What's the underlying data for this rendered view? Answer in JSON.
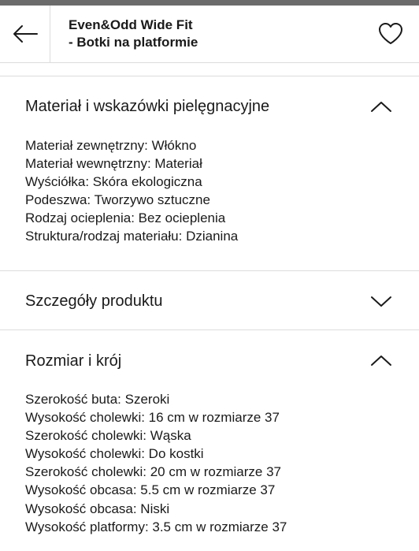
{
  "header": {
    "title_line1": "Even&Odd Wide Fit",
    "title_line2": "- Botki na platformie"
  },
  "sections": [
    {
      "title": "Materiał i wskazówki pielęgnacyjne",
      "expanded": true,
      "items": [
        "Materiał zewnętrzny: Włókno",
        "Materiał wewnętrzny: Materiał",
        "Wyściółka: Skóra ekologiczna",
        "Podeszwa: Tworzywo sztuczne",
        "Rodzaj ocieplenia: Bez ocieplenia",
        "Struktura/rodzaj materiału: Dzianina"
      ]
    },
    {
      "title": "Szczegóły produktu",
      "expanded": false,
      "items": []
    },
    {
      "title": "Rozmiar i krój",
      "expanded": true,
      "items": [
        "Szerokość buta: Szeroki",
        "Wysokość cholewki: 16 cm w rozmiarze 37",
        "Szerokość cholewki: Wąska",
        "Wysokość cholewki: Do kostki",
        "Szerokość cholewki: 20 cm w rozmiarze 37",
        "Wysokość obcasa: 5.5 cm w rozmiarze 37",
        "Wysokość obcasa: Niski",
        "Wysokość platformy: 3.5 cm w rozmiarze 37"
      ]
    }
  ],
  "icons": {
    "back": "arrow-left-icon",
    "favorite": "heart-outline-icon",
    "collapse": "chevron-up-icon",
    "expand": "chevron-down-icon"
  },
  "colors": {
    "text": "#1a1a1a",
    "divider": "#dcdcdc",
    "top_strip": "#6b6b6b"
  }
}
